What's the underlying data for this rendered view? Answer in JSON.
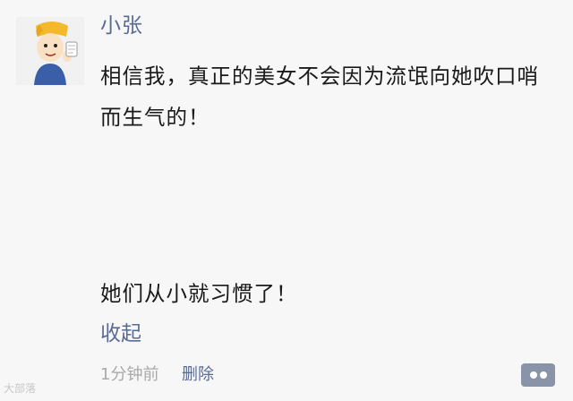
{
  "post": {
    "author": "小张",
    "text_main": "相信我，真正的美女不会因为流氓向她吹口哨而生气的！",
    "text_followup": "她们从小就习惯了！",
    "collapse_label": "收起",
    "timestamp": "1分钟前",
    "delete_label": "删除"
  },
  "icons": {
    "avatar": "cartoon-boy-avatar",
    "comment": "comment-dots-icon"
  },
  "watermark": "大部落"
}
